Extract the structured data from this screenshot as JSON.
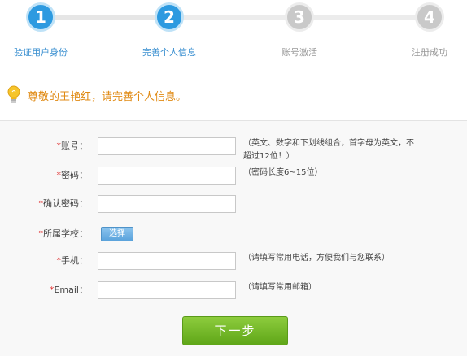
{
  "steps": [
    {
      "number": "1",
      "label": "验证用户身份",
      "state": "done"
    },
    {
      "number": "2",
      "label": "完善个人信息",
      "state": "done"
    },
    {
      "number": "3",
      "label": "账号激活",
      "state": "todo"
    },
    {
      "number": "4",
      "label": "注册成功",
      "state": "todo"
    }
  ],
  "notice": {
    "icon": "lightbulb-icon",
    "text": "尊敬的王艳红，请完善个人信息。"
  },
  "form": {
    "required_mark": "*",
    "account": {
      "label": "账号：",
      "value": "",
      "placeholder": "",
      "hint": "（英文、数字和下划线组合，首字母为英文，不超过12位！）"
    },
    "password": {
      "label": "密码：",
      "value": "",
      "placeholder": "",
      "hint": "（密码长度6~15位）"
    },
    "confirm_password": {
      "label": "确认密码：",
      "value": "",
      "placeholder": ""
    },
    "school": {
      "label": "所属学校：",
      "button_label": "选择"
    },
    "phone": {
      "label": "手机：",
      "value": "",
      "placeholder": "",
      "hint": "（请填写常用电话，方便我们与您联系）"
    },
    "email": {
      "label": "Email：",
      "value": "",
      "placeholder": "",
      "hint": "（请填写常用邮箱）"
    },
    "next_button_label": "下一步"
  },
  "colors": {
    "accent": "#2d9ae0",
    "inactive": "#c9c9c9",
    "notice": "#e08a13",
    "required": "#e03030",
    "next_button": "#6fb52a"
  }
}
